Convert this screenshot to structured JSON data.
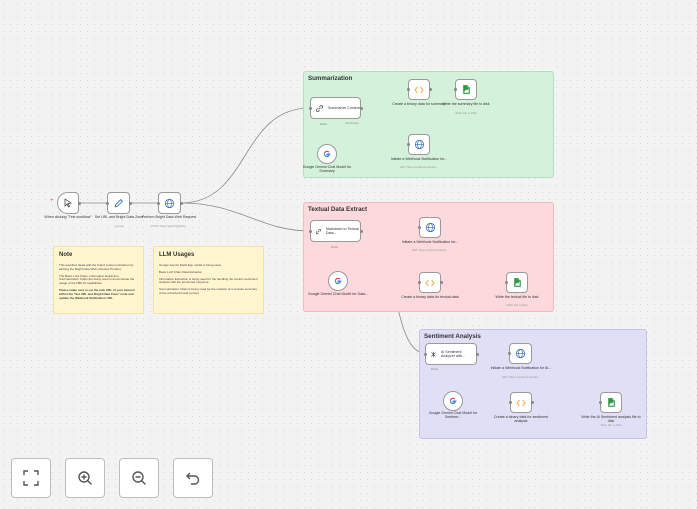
{
  "groups": {
    "summarization": {
      "title": "Summarization"
    },
    "textual": {
      "title": "Textual Data Extract"
    },
    "sentiment": {
      "title": "Sentiment Analysis"
    }
  },
  "nodes": {
    "trigger": {
      "label": "When clicking \"Test workflow\""
    },
    "set_url": {
      "label": "Set URL and Bright Data Zone",
      "sub": "manual"
    },
    "bright_request": {
      "label": "Perform Bright Data Web Request",
      "sub": "POST: https://api.brightdata..."
    },
    "summarize": {
      "label": "Summarize Content"
    },
    "gemini_summary": {
      "label": "Google Gemini Chat Model for Summary"
    },
    "binary_summary": {
      "label": "Create a binary data for summary"
    },
    "write_summary": {
      "label": "Write the summary file to disk",
      "sub": "Write File to Disk"
    },
    "webhook_summary": {
      "label": "Initiate a Webhook Notification for...",
      "sub": "GET: https://webhook.site/da..."
    },
    "markdown": {
      "label": "Markdown to Textual Data..."
    },
    "gemini_data": {
      "label": "Google Gemini Chat Model for Data..."
    },
    "webhook_textual": {
      "label": "Initiate a Webhook Notification for...",
      "sub": "GET: https://webhook.site/d..."
    },
    "binary_textual": {
      "label": "Create a binary data for textual data"
    },
    "write_textual": {
      "label": "Write the textual file to disk",
      "sub": "Write File to Disk"
    },
    "sentiment": {
      "label": "AI Sentiment Analyzer with..."
    },
    "gemini_sentiment": {
      "label": "Google Gemini Chat Model for Sentime..."
    },
    "webhook_sentiment": {
      "label": "Initiate a Webhook Notification for AI...",
      "sub": "GET: https://webhook.site/da..."
    },
    "binary_sentiment": {
      "label": "Create a binary data for sentiment analysis"
    },
    "write_sentiment": {
      "label": "Write the AI Sentiment analysis file to disk",
      "sub": "Write File to Disk"
    }
  },
  "tags": {
    "chat_model": "Chat Model",
    "sub_prompt": "Sub Prompt",
    "model": "Model"
  },
  "notes": {
    "note": {
      "title": "Note",
      "p1": "This workflow deals with the brand content extraction by utilizing the Bright Data Web Unlocker Product.",
      "p2": "The Basic LLM Chain, Information Extraction, Summarization Chain are being used to demonstrate the usage of the N8N AI capabilities.",
      "p3": "Please make sure to set the web URL of your interest within the \"Set URL and Bright Data Zone\" node and update the Webhook Notification URL"
    },
    "llm": {
      "title": "LLM Usages",
      "p1": "Google Gemini Flash Exp model is being used.",
      "p2": "Basic LLM Chain Data Extractor.",
      "p3": "Information Extraction is being used for the handling the custom sentiment analysis with the structured response.",
      "p4": "Summarization Chain is being used for the creation of a concise summary of the extracted brand content"
    }
  },
  "controls": {
    "fit": "fit-to-view",
    "zoom_in": "zoom-in",
    "zoom_out": "zoom-out",
    "undo": "undo"
  },
  "colors": {
    "summarization_bg": "#d4f1dc",
    "textual_bg": "#fdd8dc",
    "sentiment_bg": "#e1dff6",
    "sticky_bg": "#fff6d0",
    "accent_orange": "#f39a34",
    "file_green": "#2e9a45",
    "web_blue": "#3b6fb6"
  }
}
